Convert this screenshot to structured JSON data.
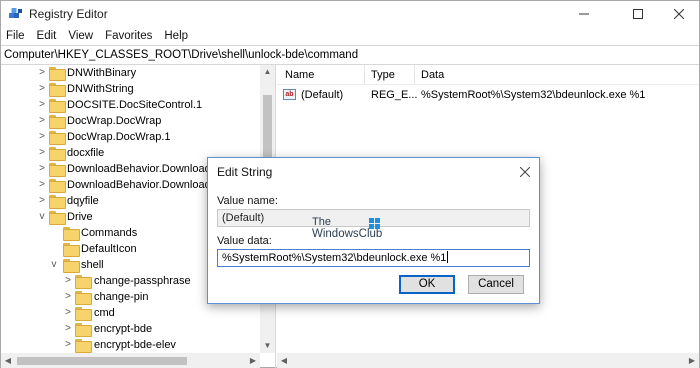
{
  "window": {
    "title": "Registry Editor"
  },
  "menu": [
    "File",
    "Edit",
    "View",
    "Favorites",
    "Help"
  ],
  "address": "Computer\\HKEY_CLASSES_ROOT\\Drive\\shell\\unlock-bde\\command",
  "tree": [
    {
      "label": "DNWithBinary",
      "expander": ">"
    },
    {
      "label": "DNWithString",
      "expander": ">"
    },
    {
      "label": "DOCSITE.DocSiteControl.1",
      "expander": ">"
    },
    {
      "label": "DocWrap.DocWrap",
      "expander": ">"
    },
    {
      "label": "DocWrap.DocWrap.1",
      "expander": ">"
    },
    {
      "label": "docxfile",
      "expander": ">"
    },
    {
      "label": "DownloadBehavior.DownloadB",
      "expander": ">"
    },
    {
      "label": "DownloadBehavior.DownloadB",
      "expander": ">"
    },
    {
      "label": "dqyfile",
      "expander": ">"
    },
    {
      "label": "Drive",
      "expander": "v"
    },
    {
      "label": "Commands",
      "expander": ""
    },
    {
      "label": "DefaultIcon",
      "expander": ""
    },
    {
      "label": "shell",
      "expander": "v"
    },
    {
      "label": "change-passphrase",
      "expander": ">"
    },
    {
      "label": "change-pin",
      "expander": ">"
    },
    {
      "label": "cmd",
      "expander": ">"
    },
    {
      "label": "encrypt-bde",
      "expander": ">"
    },
    {
      "label": "encrypt-bde-elev",
      "expander": ">"
    }
  ],
  "list": {
    "columns": [
      "Name",
      "Type",
      "Data"
    ],
    "rows": [
      {
        "name": "(Default)",
        "type": "REG_E...",
        "data": "%SystemRoot%\\System32\\bdeunlock.exe %1",
        "icon": "ab-icon"
      }
    ]
  },
  "dialog": {
    "title": "Edit String",
    "value_name_label": "Value name:",
    "value_name": "(Default)",
    "value_data_label": "Value data:",
    "value_data": "%SystemRoot%\\System32\\bdeunlock.exe %1",
    "ok_label": "OK",
    "cancel_label": "Cancel"
  },
  "watermark": {
    "line1": "The",
    "line2": "WindowsClub"
  },
  "colors": {
    "accent": "#0a64c8",
    "dialog_border": "#5b8fd6",
    "folder": "#f6d36b"
  }
}
